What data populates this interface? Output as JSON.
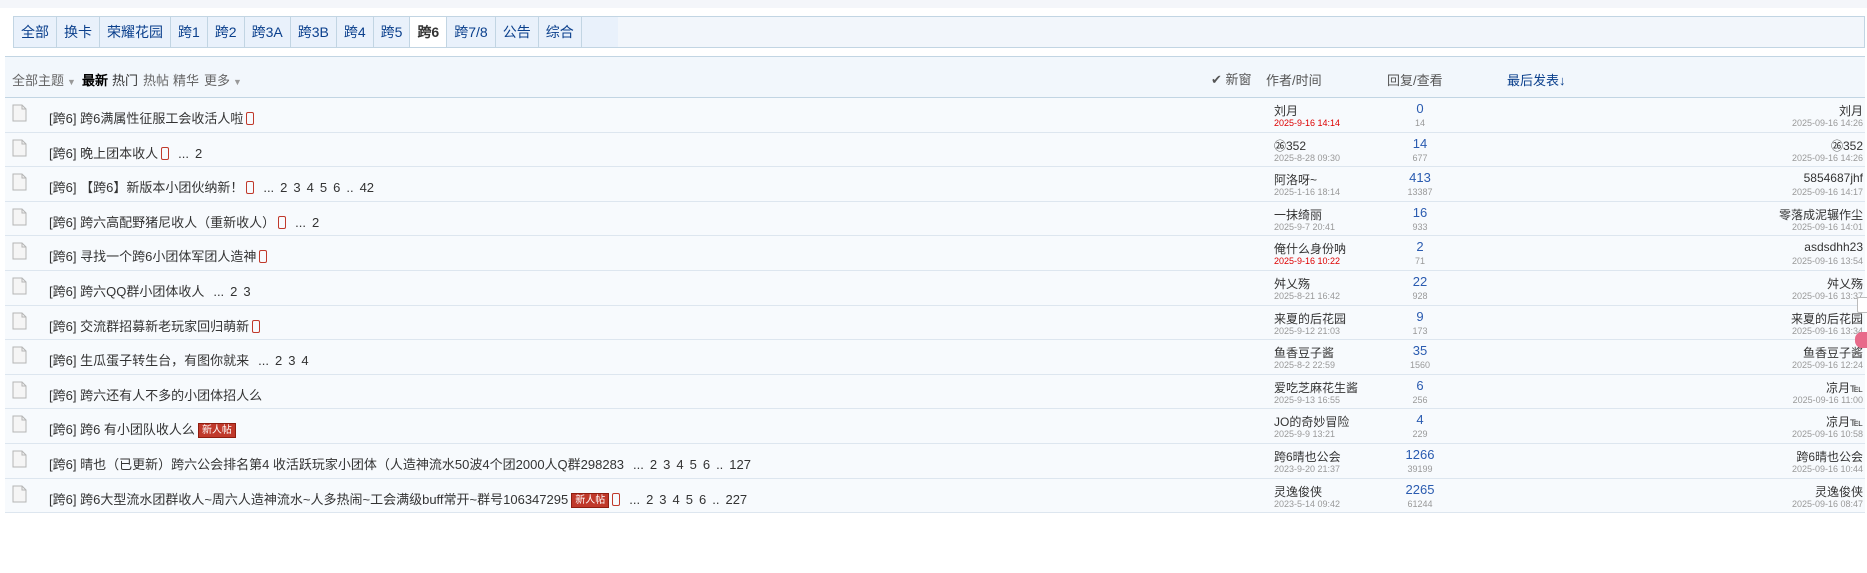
{
  "tabs": [
    {
      "label": "全部",
      "active": false
    },
    {
      "label": "换卡",
      "active": false
    },
    {
      "label": "荣耀花园",
      "active": false
    },
    {
      "label": "跨1",
      "active": false
    },
    {
      "label": "跨2",
      "active": false
    },
    {
      "label": "跨3A",
      "active": false
    },
    {
      "label": "跨3B",
      "active": false
    },
    {
      "label": "跨4",
      "active": false
    },
    {
      "label": "跨5",
      "active": false
    },
    {
      "label": "跨6",
      "active": true
    },
    {
      "label": "跨7/8",
      "active": false
    },
    {
      "label": "公告",
      "active": false
    },
    {
      "label": "综合",
      "active": false
    }
  ],
  "filters": {
    "all_topics": "全部主题",
    "latest": "最新",
    "hot": "热门",
    "hot_posts": "热帖",
    "digest": "精华",
    "more": "更多",
    "new_window": "新窗",
    "author_time": "作者/时间",
    "reply_view": "回复/查看",
    "last_post": "最后发表↓"
  },
  "threads": [
    {
      "tag": "[跨6]",
      "title": "跨6满属性征服工会收活人啦",
      "phone": true,
      "new": false,
      "pages": [],
      "author": "刘月",
      "date": "2025-9-16 14:14",
      "date_red": true,
      "replies": "0",
      "views": "14",
      "last_user": "刘月",
      "last_date": "2025-09-16 14:26"
    },
    {
      "tag": "[跨6]",
      "title": "晚上团本收人",
      "phone": true,
      "new": false,
      "pages": [
        "...",
        "2"
      ],
      "author": "㉖352",
      "date": "2025-8-28 09:30",
      "date_red": false,
      "replies": "14",
      "views": "677",
      "last_user": "㉖352",
      "last_date": "2025-09-16 14:26"
    },
    {
      "tag": "[跨6]",
      "title": "【跨6】新版本小团伙纳新！",
      "phone": true,
      "new": false,
      "pages": [
        "...",
        "2",
        "3",
        "4",
        "5",
        "6",
        "..",
        "42"
      ],
      "author": "阿洛呀~",
      "date": "2025-1-16 18:14",
      "date_red": false,
      "replies": "413",
      "views": "13387",
      "last_user": "5854687jhf",
      "last_date": "2025-09-16 14:17"
    },
    {
      "tag": "[跨6]",
      "title": "跨六高配野猪尼收人（重新收人）",
      "phone": true,
      "new": false,
      "pages": [
        "...",
        "2"
      ],
      "author": "一抹绮丽",
      "date": "2025-9-7 20:41",
      "date_red": false,
      "replies": "16",
      "views": "933",
      "last_user": "零落成泥辗作尘",
      "last_date": "2025-09-16 14:01"
    },
    {
      "tag": "[跨6]",
      "title": "寻找一个跨6小团体军团人造神",
      "phone": true,
      "new": false,
      "pages": [],
      "author": "俺什么身份呐",
      "date": "2025-9-16 10:22",
      "date_red": true,
      "replies": "2",
      "views": "71",
      "last_user": "asdsdhh23",
      "last_date": "2025-09-16 13:54"
    },
    {
      "tag": "[跨6]",
      "title": "跨六QQ群小团体收人",
      "phone": false,
      "new": false,
      "pages": [
        "...",
        "2",
        "3"
      ],
      "author": "舛乂殇",
      "date": "2025-8-21 16:42",
      "date_red": false,
      "replies": "22",
      "views": "928",
      "last_user": "舛乂殇",
      "last_date": "2025-09-16 13:37"
    },
    {
      "tag": "[跨6]",
      "title": "交流群招募新老玩家回归萌新",
      "phone": true,
      "new": false,
      "pages": [],
      "author": "来夏的后花园",
      "date": "2025-9-12 21:03",
      "date_red": false,
      "replies": "9",
      "views": "173",
      "last_user": "来夏的后花园",
      "last_date": "2025-09-16 13:34"
    },
    {
      "tag": "[跨6]",
      "title": "生瓜蛋子转生台，有图你就来",
      "phone": false,
      "new": false,
      "pages": [
        "...",
        "2",
        "3",
        "4"
      ],
      "author": "鱼香豆子酱",
      "date": "2025-8-2 22:59",
      "date_red": false,
      "replies": "35",
      "views": "1560",
      "last_user": "鱼香豆子酱",
      "last_date": "2025-09-16 12:24"
    },
    {
      "tag": "[跨6]",
      "title": "跨六还有人不多的小团体招人么",
      "phone": false,
      "new": false,
      "pages": [],
      "author": "爱吃芝麻花生酱",
      "date": "2025-9-13 16:55",
      "date_red": false,
      "replies": "6",
      "views": "256",
      "last_user": "凉月℡",
      "last_date": "2025-09-16 11:00"
    },
    {
      "tag": "[跨6]",
      "title": "跨6 有小团队收人么",
      "phone": false,
      "new": true,
      "pages": [],
      "author": "JO的奇妙冒险",
      "date": "2025-9-9 13:21",
      "date_red": false,
      "replies": "4",
      "views": "229",
      "last_user": "凉月℡",
      "last_date": "2025-09-16 10:58"
    },
    {
      "tag": "[跨6]",
      "title": "晴也（已更新）跨六公会排名第4 收活跃玩家小团体（人造神流水50波4个团2000人Q群298283",
      "phone": false,
      "new": false,
      "pages": [
        "...",
        "2",
        "3",
        "4",
        "5",
        "6",
        "..",
        "127"
      ],
      "author": "跨6晴也公会",
      "date": "2023-9-20 21:37",
      "date_red": false,
      "replies": "1266",
      "views": "39199",
      "last_user": "跨6晴也公会",
      "last_date": "2025-09-16 10:44"
    },
    {
      "tag": "[跨6]",
      "title": "跨6大型流水团群收人~周六人造神流水~人多热闹~工会满级buff常开~群号106347295",
      "phone": true,
      "new": true,
      "pages": [
        "...",
        "2",
        "3",
        "4",
        "5",
        "6",
        "..",
        "227"
      ],
      "author": "灵逸俊侠",
      "date": "2023-5-14 09:42",
      "date_red": false,
      "replies": "2265",
      "views": "61244",
      "last_user": "灵逸俊侠",
      "last_date": "2025-09-16 08:47"
    }
  ],
  "labels": {
    "new_badge": "新人帖"
  }
}
